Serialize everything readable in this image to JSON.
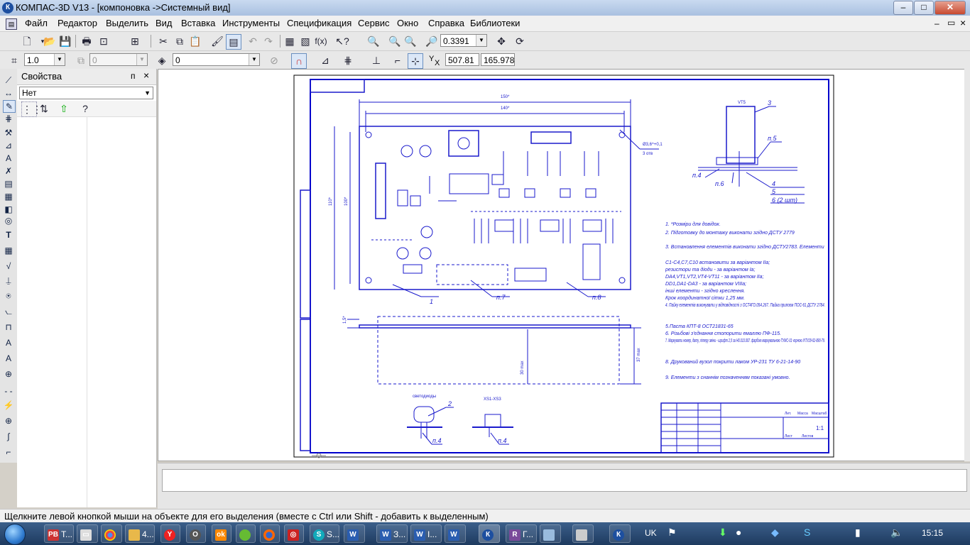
{
  "window": {
    "title": "КОМПАС-3D V13 - [компоновка ->Системный вид]",
    "app_icon": "К",
    "controls": [
      "–",
      "□",
      "✕"
    ],
    "doc_controls": [
      "–",
      "▭",
      "×"
    ]
  },
  "menu": [
    "Файл",
    "Редактор",
    "Выделить",
    "Вид",
    "Вставка",
    "Инструменты",
    "Спецификация",
    "Сервис",
    "Окно",
    "Справка",
    "Библиотеки"
  ],
  "toolbar1": {
    "zoom_value": "0.3391"
  },
  "toolbar2": {
    "step_value": "1.0",
    "angle_value": "0",
    "layer_value": "0",
    "coord_x": "507.81",
    "coord_y": "165.978",
    "x_label": "Y",
    "y_label": "X"
  },
  "properties": {
    "title": "Свойства",
    "pin": "ᴨ",
    "close": "×",
    "selected": "Нет"
  },
  "status": {
    "hint": "Щелкните левой кнопкой мыши на объекте для его выделения (вместе с Ctrl или Shift - добавить к выделенным)"
  },
  "taskbar": {
    "items": [
      {
        "label": "Т...",
        "icon": "PB"
      },
      {
        "label": "",
        "icon": "chrome"
      },
      {
        "label": "4...",
        "icon": "folder"
      },
      {
        "label": "",
        "icon": "yandex"
      },
      {
        "label": "",
        "icon": "opera"
      },
      {
        "label": "",
        "icon": "ok"
      },
      {
        "label": "",
        "icon": "winamp"
      },
      {
        "label": "",
        "icon": "firefox"
      },
      {
        "label": "S...",
        "icon": "skype"
      },
      {
        "label": "З...",
        "icon": "word"
      },
      {
        "label": "I...",
        "icon": "word"
      },
      {
        "label": "",
        "icon": "word"
      },
      {
        "label": "",
        "icon": "kompas"
      },
      {
        "label": "Г...",
        "icon": "winrar"
      },
      {
        "label": "",
        "icon": "explorer"
      },
      {
        "label": "",
        "icon": "app"
      },
      {
        "label": "",
        "icon": "kompas"
      }
    ],
    "language": "UK",
    "clock": "15:15"
  },
  "drawing": {
    "dim_150": "150*",
    "dim_140": "140*",
    "dim_110": "110*",
    "dim_100": "100*",
    "hole_note": "Ø3,6^+0,1",
    "hole_count": "3 отв",
    "dim_15": "1,5*",
    "dim_30": "30 max",
    "dim_37": "37 max",
    "callout_1": "1",
    "callout_p7": "п.7",
    "callout_p8": "п.8",
    "callout_3": "3",
    "callout_p5": "п.5",
    "callout_p4": "п.4",
    "callout_p6": "п.6",
    "callout_4": "4",
    "callout_5": "5",
    "callout_6": "6 (2 шт)",
    "callout_2": "2",
    "label_vt": "VT5",
    "label_led": "светодиоды",
    "label_xs": "XS1-XS3",
    "notes": [
      "1. *Розміри для довідок.",
      "2. Підготовку до монтажу виконати згідно ДСТУ 2779",
      "3. Встановлення елементів виконати згідно ДСТУ2783. Елементи",
      "C1-C4,C7,C10 встановити за варіантом IIa;",
      "резистори та діоди - за варіантом Ia;",
      "DA4,VT1,VT2,VT4-VT11 - за варіантом IIa;",
      "DD1,DA1-DA3 - за варіантом VIIIa;",
      "інші елементи - згідно креслення.",
      "Крок координатної сітки 1,25 мм.",
      "4. Пайку елементів виконувати у відповідності з ОСТ4ГО.054.267. Пайка припоєм ПОС-61 ДСТУ 2784.",
      "5.Паста КПТ-8 ОСТ21831-65",
      "6. Різьбові з'єднання стопорити емаллю ПФ-115.",
      "7. Маркувати номер, дату, літеру зміни - шрифт 2,5 за Н0.010.007. фарбою маркувальною ТУМС-01 чорною УІТУ29-02-890-79.",
      "8. Друкований вузол покрити лаком УР-231 ТУ 6-21-14-90",
      "9. Елементи з снаннім позначенням показані умовно."
    ],
    "stamp_letter": "Лит.",
    "stamp_mass": "Масса",
    "stamp_scale": "Масштаб",
    "stamp_scale_val": "1:1",
    "stamp_sheet": "Лист",
    "stamp_sheets": "Листов"
  },
  "colors": {
    "drawing_line": "#1a1acc",
    "frame": "#0000cc",
    "taskbar": "#2a4a72"
  }
}
